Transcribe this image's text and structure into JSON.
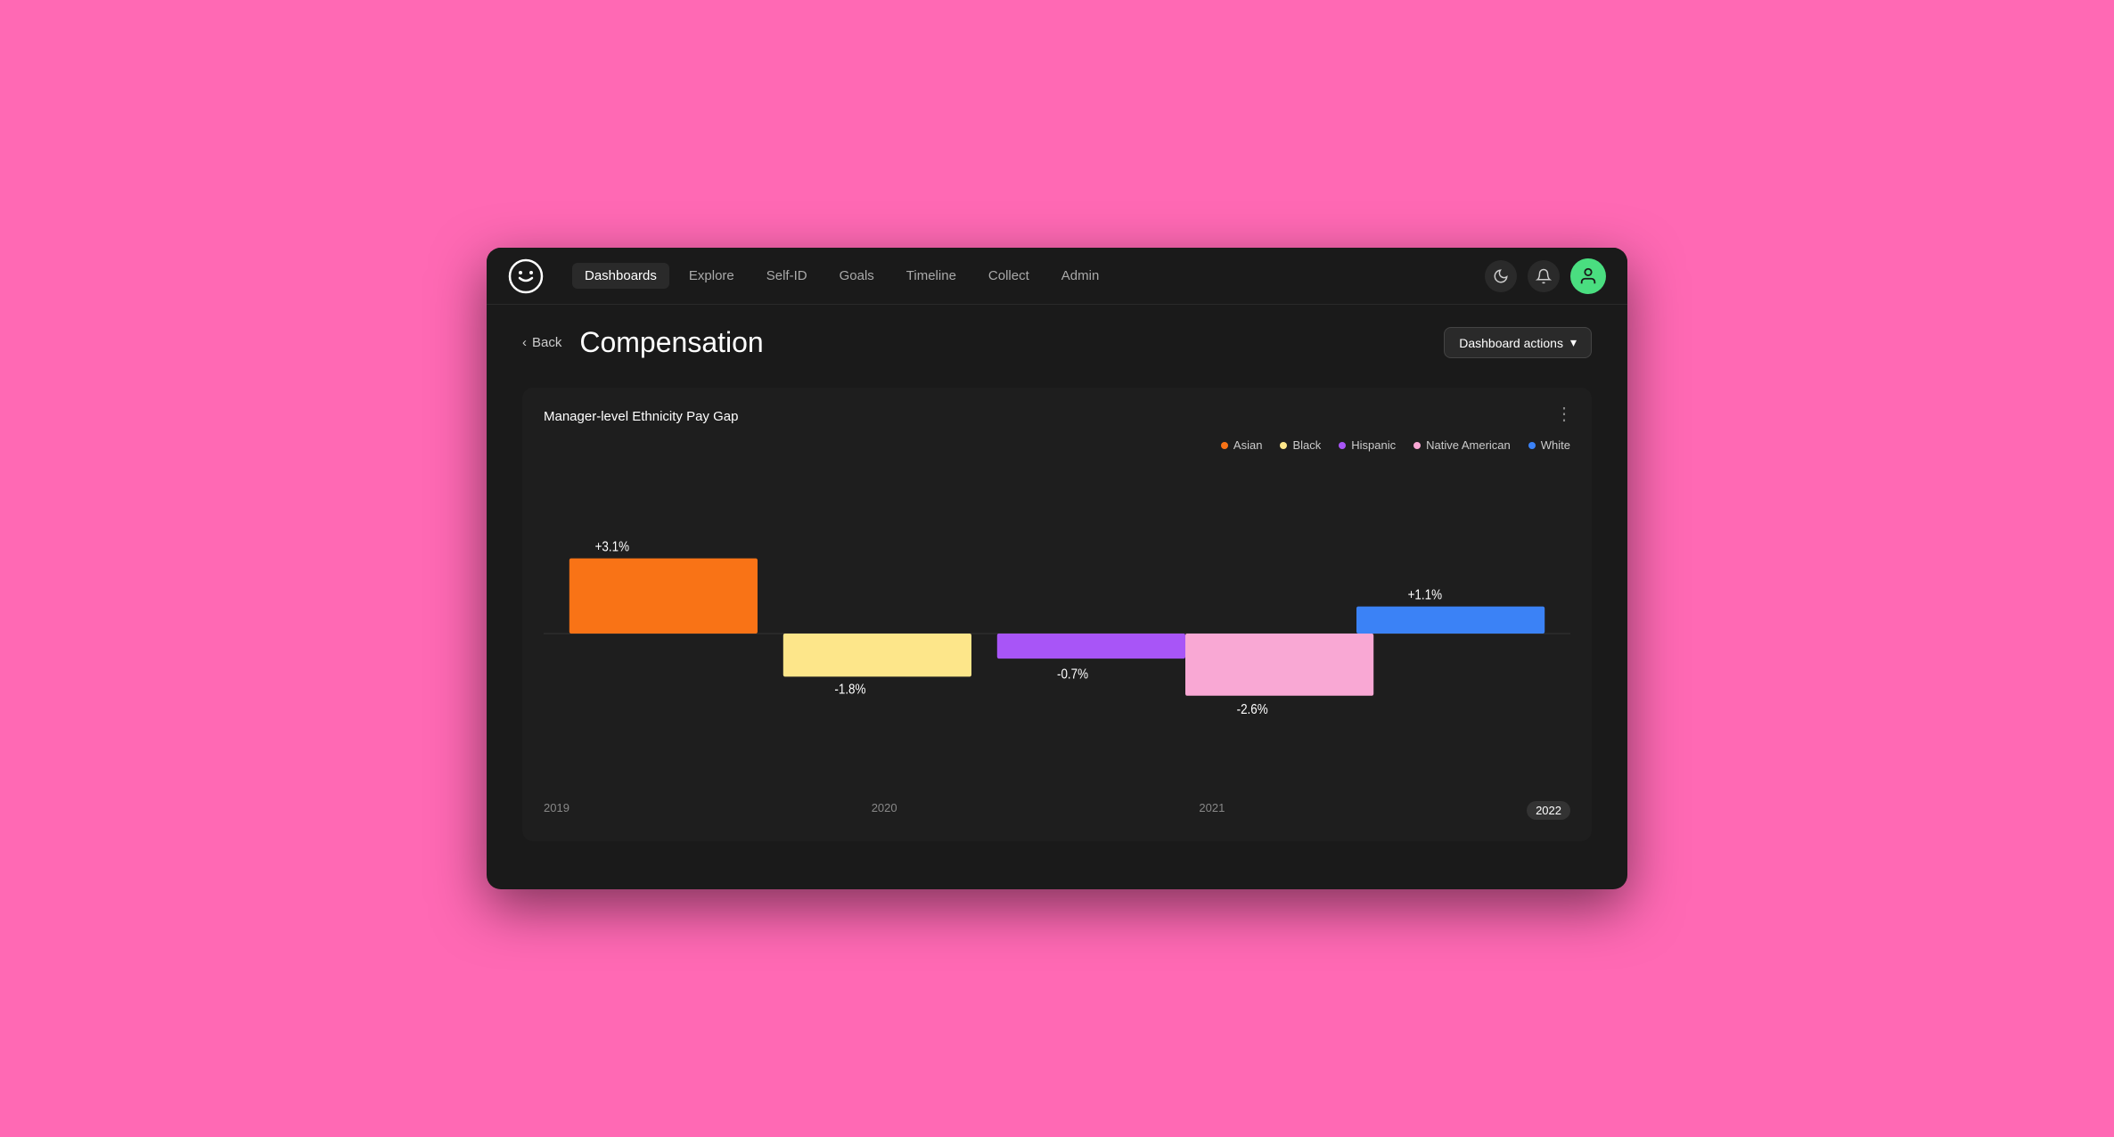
{
  "app": {
    "logo_symbol": "☺"
  },
  "nav": {
    "links": [
      {
        "label": "Dashboards",
        "active": true
      },
      {
        "label": "Explore",
        "active": false
      },
      {
        "label": "Self-ID",
        "active": false
      },
      {
        "label": "Goals",
        "active": false
      },
      {
        "label": "Timeline",
        "active": false
      },
      {
        "label": "Collect",
        "active": false
      },
      {
        "label": "Admin",
        "active": false
      }
    ],
    "dark_mode_icon": "🌙",
    "notification_icon": "🔔"
  },
  "page": {
    "back_label": "Back",
    "title": "Compensation",
    "dashboard_actions_label": "Dashboard actions"
  },
  "chart": {
    "title": "Manager-level Ethnicity Pay Gap",
    "legend": [
      {
        "label": "Asian",
        "color": "#f97316"
      },
      {
        "label": "Black",
        "color": "#fde68a"
      },
      {
        "label": "Hispanic",
        "color": "#a855f7"
      },
      {
        "label": "Native American",
        "color": "#f9a8d4"
      },
      {
        "label": "White",
        "color": "#3b82f6"
      }
    ],
    "bars": [
      {
        "label": "Asian 2019",
        "value": 3.1,
        "color": "#f97316",
        "display": "+3.1%",
        "positive": true
      },
      {
        "label": "Black 2020",
        "value": -1.8,
        "color": "#fde68a",
        "display": "-1.8%",
        "positive": false
      },
      {
        "label": "Hispanic 2021",
        "value": -0.7,
        "color": "#a855f7",
        "display": "-0.7%",
        "positive": false
      },
      {
        "label": "Native American 2021",
        "value": -2.6,
        "color": "#f9a8d4",
        "display": "-2.6%",
        "positive": false
      },
      {
        "label": "White 2022",
        "value": 1.1,
        "color": "#3b82f6",
        "display": "+1.1%",
        "positive": true
      }
    ],
    "x_labels": [
      "2019",
      "2020",
      "2021",
      "2022"
    ],
    "active_x_label": "2022"
  }
}
